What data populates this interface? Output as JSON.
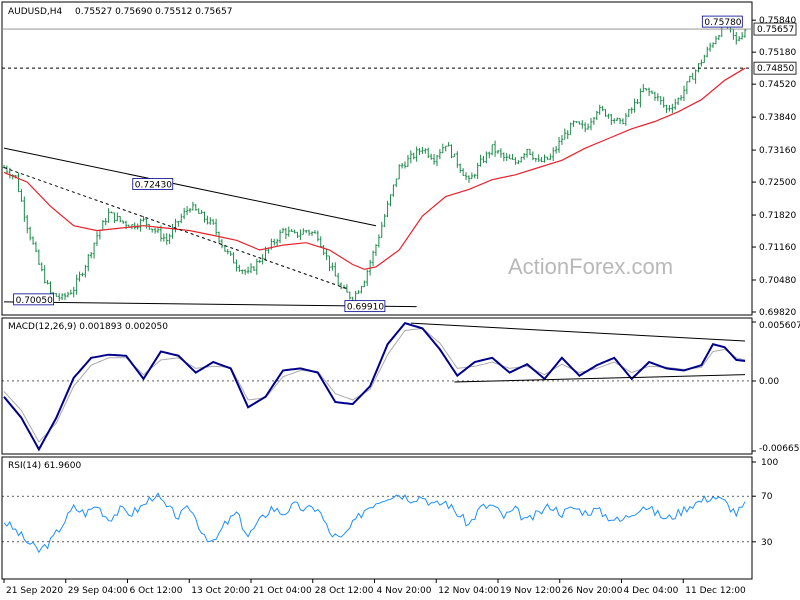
{
  "header": {
    "symbol": "AUDUSD,H4",
    "ohlc": "0.75527 0.75690 0.75512 0.75657"
  },
  "watermark": "ActionForex.com",
  "colors": {
    "candle": "#1f8a4c",
    "ma": "#e8222b",
    "trendline": "#000000",
    "macd": "#00008b",
    "signal": "#aaaaaa",
    "rsi": "#1e90ff",
    "grid": "#000000"
  },
  "chart_data": [
    {
      "type": "candlestick",
      "title": "AUDUSD,H4",
      "price_ticks": [
        "0.75840",
        "0.75180",
        "0.74520",
        "0.73840",
        "0.73160",
        "0.72500",
        "0.71820",
        "0.71160",
        "0.70480",
        "0.69820"
      ],
      "ylim": [
        0.6982,
        0.7605
      ],
      "x_labels": [
        "21 Sep 2020",
        "29 Sep 04:00",
        "6 Oct 12:00",
        "13 Oct 20:00",
        "21 Oct 04:00",
        "28 Oct 12:00",
        "4 Nov 20:00",
        "12 Nov 04:00",
        "19 Nov 12:00",
        "26 Nov 20:00",
        "4 Dec 04:00",
        "11 Dec 12:00"
      ],
      "current_price": "0.75657",
      "level_line": "0.74850",
      "annotations": [
        "0.72430",
        "0.70050",
        "0.69910",
        "0.75780"
      ],
      "close_path": [
        [
          0,
          0.728
        ],
        [
          4,
          0.726
        ],
        [
          8,
          0.716
        ],
        [
          12,
          0.708
        ],
        [
          16,
          0.702
        ],
        [
          20,
          0.701
        ],
        [
          24,
          0.703
        ],
        [
          28,
          0.708
        ],
        [
          32,
          0.714
        ],
        [
          36,
          0.7185
        ],
        [
          40,
          0.717
        ],
        [
          44,
          0.716
        ],
        [
          48,
          0.717
        ],
        [
          52,
          0.715
        ],
        [
          56,
          0.713
        ],
        [
          60,
          0.717
        ],
        [
          64,
          0.72
        ],
        [
          68,
          0.718
        ],
        [
          72,
          0.716
        ],
        [
          76,
          0.711
        ],
        [
          80,
          0.708
        ],
        [
          84,
          0.706
        ],
        [
          88,
          0.709
        ],
        [
          92,
          0.712
        ],
        [
          96,
          0.715
        ],
        [
          100,
          0.714
        ],
        [
          104,
          0.715
        ],
        [
          108,
          0.714
        ],
        [
          112,
          0.708
        ],
        [
          116,
          0.703
        ],
        [
          120,
          0.701
        ],
        [
          124,
          0.705
        ],
        [
          128,
          0.712
        ],
        [
          132,
          0.72
        ],
        [
          136,
          0.728
        ],
        [
          140,
          0.73
        ],
        [
          144,
          0.732
        ],
        [
          148,
          0.73
        ],
        [
          152,
          0.733
        ],
        [
          156,
          0.729
        ],
        [
          160,
          0.725
        ],
        [
          164,
          0.729
        ],
        [
          168,
          0.732
        ],
        [
          172,
          0.73
        ],
        [
          176,
          0.729
        ],
        [
          180,
          0.732
        ],
        [
          184,
          0.729
        ],
        [
          188,
          0.73
        ],
        [
          192,
          0.734
        ],
        [
          196,
          0.737
        ],
        [
          200,
          0.736
        ],
        [
          204,
          0.74
        ],
        [
          208,
          0.739
        ],
        [
          212,
          0.737
        ],
        [
          216,
          0.74
        ],
        [
          220,
          0.744
        ],
        [
          224,
          0.743
        ],
        [
          228,
          0.74
        ],
        [
          232,
          0.742
        ],
        [
          236,
          0.746
        ],
        [
          240,
          0.75
        ],
        [
          244,
          0.754
        ],
        [
          248,
          0.7578
        ],
        [
          252,
          0.754
        ],
        [
          255,
          0.7566
        ]
      ],
      "ma_path": [
        [
          0,
          0.727
        ],
        [
          8,
          0.725
        ],
        [
          16,
          0.72
        ],
        [
          24,
          0.716
        ],
        [
          32,
          0.715
        ],
        [
          40,
          0.7155
        ],
        [
          48,
          0.716
        ],
        [
          56,
          0.7155
        ],
        [
          64,
          0.715
        ],
        [
          72,
          0.714
        ],
        [
          80,
          0.713
        ],
        [
          88,
          0.711
        ],
        [
          96,
          0.712
        ],
        [
          104,
          0.7125
        ],
        [
          112,
          0.711
        ],
        [
          120,
          0.708
        ],
        [
          124,
          0.707
        ],
        [
          128,
          0.7075
        ],
        [
          136,
          0.711
        ],
        [
          144,
          0.718
        ],
        [
          152,
          0.722
        ],
        [
          160,
          0.7235
        ],
        [
          168,
          0.7255
        ],
        [
          176,
          0.7265
        ],
        [
          184,
          0.728
        ],
        [
          192,
          0.7295
        ],
        [
          200,
          0.732
        ],
        [
          208,
          0.734
        ],
        [
          216,
          0.736
        ],
        [
          224,
          0.7375
        ],
        [
          232,
          0.7395
        ],
        [
          240,
          0.742
        ],
        [
          248,
          0.746
        ],
        [
          255,
          0.7485
        ]
      ],
      "trendlines": [
        {
          "from": [
            0,
            0.732
          ],
          "to": [
            128,
            0.716
          ]
        },
        {
          "from": [
            0,
            0.728
          ],
          "to": [
            118,
            0.703
          ],
          "dashed": true
        },
        {
          "from": [
            0,
            0.7003
          ],
          "to": [
            142,
            0.6993
          ]
        }
      ]
    },
    {
      "type": "line",
      "title": "MACD(12,26,9) 0.001893 0.002050",
      "ticks": [
        "0.005607",
        "0.00",
        "-0.006656"
      ],
      "ylim": [
        -0.006656,
        0.005607
      ],
      "series": [
        {
          "name": "MACD(12,26,9)",
          "values": [
            [
              0,
              -0.0015
            ],
            [
              6,
              -0.0035
            ],
            [
              12,
              -0.0065
            ],
            [
              18,
              -0.0035
            ],
            [
              24,
              0.0003
            ],
            [
              30,
              0.0022
            ],
            [
              36,
              0.0025
            ],
            [
              42,
              0.0024
            ],
            [
              48,
              0.0002
            ],
            [
              54,
              0.0028
            ],
            [
              60,
              0.0024
            ],
            [
              66,
              0.0008
            ],
            [
              72,
              0.0018
            ],
            [
              78,
              0.0012
            ],
            [
              84,
              -0.0025
            ],
            [
              90,
              -0.0015
            ],
            [
              96,
              0.001
            ],
            [
              102,
              0.0012
            ],
            [
              108,
              0.0008
            ],
            [
              114,
              -0.002
            ],
            [
              120,
              -0.0022
            ],
            [
              126,
              -0.0005
            ],
            [
              132,
              0.0035
            ],
            [
              138,
              0.0055
            ],
            [
              144,
              0.005
            ],
            [
              150,
              0.003
            ],
            [
              156,
              0.0005
            ],
            [
              162,
              0.0018
            ],
            [
              168,
              0.0022
            ],
            [
              174,
              0.0008
            ],
            [
              180,
              0.0016
            ],
            [
              186,
              0.0002
            ],
            [
              192,
              0.0022
            ],
            [
              198,
              0.0005
            ],
            [
              204,
              0.0015
            ],
            [
              210,
              0.0022
            ],
            [
              216,
              0.0002
            ],
            [
              222,
              0.0018
            ],
            [
              228,
              0.0012
            ],
            [
              234,
              0.001
            ],
            [
              240,
              0.0015
            ],
            [
              244,
              0.0035
            ],
            [
              248,
              0.0032
            ],
            [
              252,
              0.002
            ],
            [
              255,
              0.0019
            ]
          ]
        },
        {
          "name": "signal",
          "values": [
            [
              0,
              -0.001
            ],
            [
              6,
              -0.0028
            ],
            [
              12,
              -0.0058
            ],
            [
              18,
              -0.004
            ],
            [
              24,
              -0.0005
            ],
            [
              30,
              0.0015
            ],
            [
              36,
              0.0022
            ],
            [
              42,
              0.0022
            ],
            [
              48,
              0.0006
            ],
            [
              54,
              0.002
            ],
            [
              60,
              0.0022
            ],
            [
              66,
              0.0012
            ],
            [
              72,
              0.0014
            ],
            [
              78,
              0.0013
            ],
            [
              84,
              -0.0018
            ],
            [
              90,
              -0.0016
            ],
            [
              96,
              0.0004
            ],
            [
              102,
              0.001
            ],
            [
              108,
              0.0009
            ],
            [
              114,
              -0.0012
            ],
            [
              120,
              -0.0018
            ],
            [
              126,
              -0.0008
            ],
            [
              132,
              0.0025
            ],
            [
              138,
              0.0048
            ],
            [
              144,
              0.005
            ],
            [
              150,
              0.0036
            ],
            [
              156,
              0.0012
            ],
            [
              162,
              0.0014
            ],
            [
              168,
              0.0018
            ],
            [
              174,
              0.0012
            ],
            [
              180,
              0.0014
            ],
            [
              186,
              0.0006
            ],
            [
              192,
              0.0016
            ],
            [
              198,
              0.0008
            ],
            [
              204,
              0.0012
            ],
            [
              210,
              0.0018
            ],
            [
              216,
              0.0008
            ],
            [
              222,
              0.0014
            ],
            [
              228,
              0.0013
            ],
            [
              234,
              0.0011
            ],
            [
              240,
              0.0013
            ],
            [
              244,
              0.0028
            ],
            [
              248,
              0.003
            ],
            [
              252,
              0.0022
            ],
            [
              255,
              0.002
            ]
          ]
        }
      ],
      "trendlines": [
        {
          "from": [
            140,
            0.0055
          ],
          "to": [
            255,
            0.0038
          ]
        },
        {
          "from": [
            155,
            -0.0001
          ],
          "to": [
            255,
            0.0006
          ]
        }
      ]
    },
    {
      "type": "line",
      "title": "RSI(14) 61.9600",
      "ticks": [
        "100",
        "70",
        "30",
        "0"
      ],
      "ylim": [
        0,
        100
      ],
      "series": [
        {
          "name": "RSI(14)",
          "values": [
            [
              0,
              48
            ],
            [
              4,
              40
            ],
            [
              8,
              30
            ],
            [
              12,
              22
            ],
            [
              16,
              30
            ],
            [
              20,
              45
            ],
            [
              24,
              60
            ],
            [
              28,
              55
            ],
            [
              32,
              62
            ],
            [
              36,
              50
            ],
            [
              40,
              58
            ],
            [
              44,
              55
            ],
            [
              48,
              62
            ],
            [
              52,
              72
            ],
            [
              56,
              60
            ],
            [
              60,
              52
            ],
            [
              64,
              60
            ],
            [
              68,
              40
            ],
            [
              72,
              28
            ],
            [
              76,
              45
            ],
            [
              80,
              55
            ],
            [
              84,
              35
            ],
            [
              88,
              48
            ],
            [
              92,
              60
            ],
            [
              96,
              55
            ],
            [
              100,
              62
            ],
            [
              104,
              58
            ],
            [
              108,
              60
            ],
            [
              112,
              38
            ],
            [
              116,
              32
            ],
            [
              120,
              45
            ],
            [
              124,
              58
            ],
            [
              128,
              65
            ],
            [
              132,
              70
            ],
            [
              136,
              72
            ],
            [
              140,
              68
            ],
            [
              144,
              70
            ],
            [
              148,
              62
            ],
            [
              152,
              65
            ],
            [
              156,
              55
            ],
            [
              160,
              45
            ],
            [
              164,
              60
            ],
            [
              168,
              62
            ],
            [
              172,
              52
            ],
            [
              176,
              58
            ],
            [
              180,
              48
            ],
            [
              184,
              55
            ],
            [
              188,
              62
            ],
            [
              192,
              55
            ],
            [
              196,
              60
            ],
            [
              200,
              56
            ],
            [
              204,
              58
            ],
            [
              208,
              52
            ],
            [
              212,
              48
            ],
            [
              216,
              55
            ],
            [
              220,
              62
            ],
            [
              224,
              56
            ],
            [
              228,
              50
            ],
            [
              232,
              55
            ],
            [
              236,
              62
            ],
            [
              240,
              66
            ],
            [
              244,
              70
            ],
            [
              248,
              65
            ],
            [
              252,
              55
            ],
            [
              255,
              62
            ]
          ]
        }
      ]
    }
  ]
}
